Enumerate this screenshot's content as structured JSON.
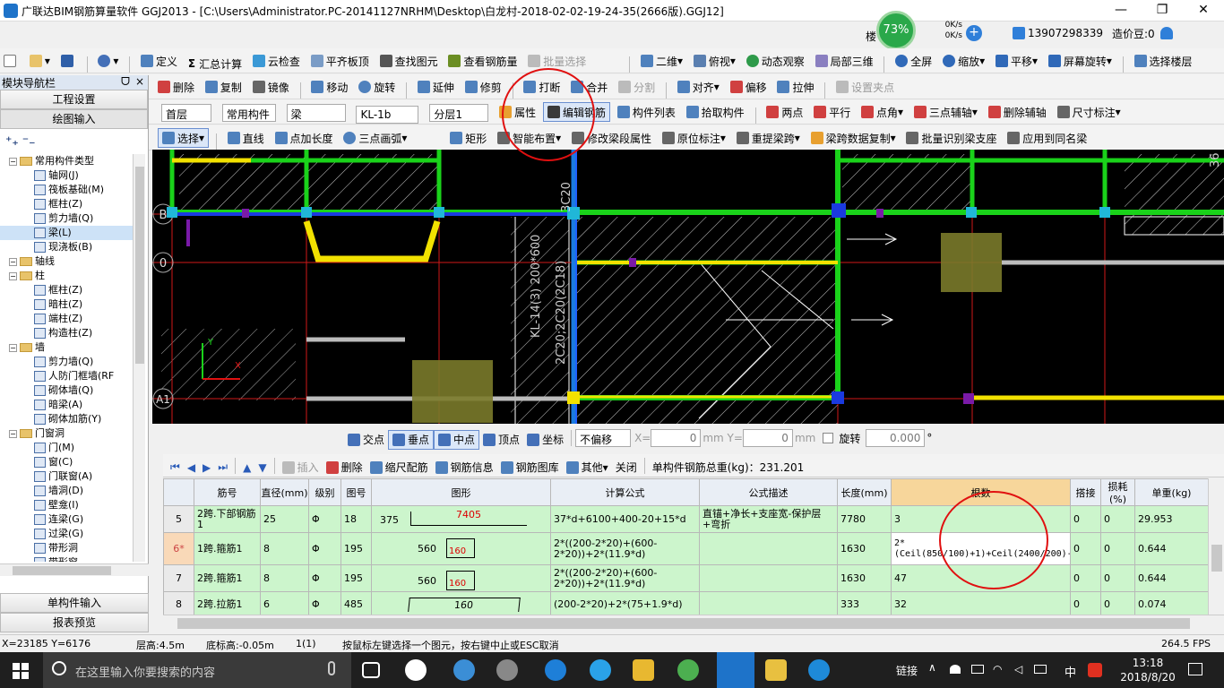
{
  "window": {
    "title": "广联达BIM钢筋算量软件 GGJ2013 - [C:\\Users\\Administrator.PC-20141127NRHM\\Desktop\\白龙村-2018-02-02-19-24-35(2666版).GGJ12]",
    "minimize": "—",
    "restore": "❐",
    "close": "✕"
  },
  "overlay": {
    "badge_prefix": "楼",
    "percent": "73%",
    "net_up": "0K/s",
    "net_down": "0K/s",
    "account": "13907298339",
    "beans": "造价豆:0"
  },
  "toolbar1": {
    "items": [
      "定义",
      "汇总计算",
      "云检查",
      "平齐板顶",
      "查找图元",
      "查看钢筋量",
      "批量选择",
      "二维",
      "俯视",
      "动态观察",
      "局部三维",
      "全屏",
      "缩放",
      "平移",
      "屏幕旋转",
      "选择楼层"
    ]
  },
  "toolbar2": {
    "items": [
      "删除",
      "复制",
      "镜像",
      "移动",
      "旋转",
      "延伸",
      "修剪",
      "打断",
      "合并",
      "分割",
      "对齐",
      "偏移",
      "拉伸",
      "设置夹点"
    ]
  },
  "toolbar3": {
    "floor": "首层",
    "type": "常用构件",
    "kind": "梁",
    "component": "KL-1b",
    "layer": "分层1",
    "items": [
      "属性",
      "编辑钢筋",
      "构件列表",
      "拾取构件",
      "两点",
      "平行",
      "点角",
      "三点辅轴",
      "删除辅轴",
      "尺寸标注"
    ]
  },
  "toolbar4": {
    "items": [
      "选择",
      "直线",
      "点加长度",
      "三点画弧",
      "矩形",
      "智能布置",
      "修改梁段属性",
      "原位标注",
      "重提梁跨",
      "梁跨数据复制",
      "批量识别梁支座",
      "应用到同名梁"
    ]
  },
  "leftpanel": {
    "title": "模块导航栏",
    "pin": "ᗜ",
    "close": "×",
    "btn_project": "工程设置",
    "btn_draw": "绘图输入",
    "tree": [
      {
        "label": "常用构件类型",
        "level": 0,
        "type": "folder"
      },
      {
        "label": "轴网(J)",
        "level": 1,
        "type": "item"
      },
      {
        "label": "筏板基础(M)",
        "level": 1,
        "type": "item"
      },
      {
        "label": "框柱(Z)",
        "level": 1,
        "type": "item"
      },
      {
        "label": "剪力墙(Q)",
        "level": 1,
        "type": "item"
      },
      {
        "label": "梁(L)",
        "level": 1,
        "type": "item",
        "selected": true
      },
      {
        "label": "现浇板(B)",
        "level": 1,
        "type": "item"
      },
      {
        "label": "轴线",
        "level": 0,
        "type": "folder"
      },
      {
        "label": "柱",
        "level": 0,
        "type": "folder"
      },
      {
        "label": "框柱(Z)",
        "level": 1,
        "type": "item"
      },
      {
        "label": "暗柱(Z)",
        "level": 1,
        "type": "item"
      },
      {
        "label": "端柱(Z)",
        "level": 1,
        "type": "item"
      },
      {
        "label": "构造柱(Z)",
        "level": 1,
        "type": "item"
      },
      {
        "label": "墙",
        "level": 0,
        "type": "folder"
      },
      {
        "label": "剪力墙(Q)",
        "level": 1,
        "type": "item"
      },
      {
        "label": "人防门框墙(RF",
        "level": 1,
        "type": "item"
      },
      {
        "label": "砌体墙(Q)",
        "level": 1,
        "type": "item"
      },
      {
        "label": "暗梁(A)",
        "level": 1,
        "type": "item"
      },
      {
        "label": "砌体加筋(Y)",
        "level": 1,
        "type": "item"
      },
      {
        "label": "门窗洞",
        "level": 0,
        "type": "folder"
      },
      {
        "label": "门(M)",
        "level": 1,
        "type": "item"
      },
      {
        "label": "窗(C)",
        "level": 1,
        "type": "item"
      },
      {
        "label": "门联窗(A)",
        "level": 1,
        "type": "item"
      },
      {
        "label": "墙洞(D)",
        "level": 1,
        "type": "item"
      },
      {
        "label": "壁龛(I)",
        "level": 1,
        "type": "item"
      },
      {
        "label": "连梁(G)",
        "level": 1,
        "type": "item"
      },
      {
        "label": "过梁(G)",
        "level": 1,
        "type": "item"
      },
      {
        "label": "带形洞",
        "level": 1,
        "type": "item"
      },
      {
        "label": "带形窗",
        "level": 1,
        "type": "item"
      }
    ],
    "btn_single": "单构件输入",
    "btn_report": "报表预览"
  },
  "canvas": {
    "axis_labels": [
      "B",
      "0",
      "A1"
    ],
    "beam_text": "KL-14(3) 200*600",
    "beam_text2": "2C20;2C20(2C18)",
    "rebar_text": "3C20",
    "top_right_text": "36"
  },
  "snapbar": {
    "items": [
      "交点",
      "垂点",
      "中点",
      "顶点",
      "坐标"
    ],
    "offset_mode": "不偏移",
    "x_label": "X=",
    "x_value": "0",
    "y_label": "mm Y=",
    "y_value": "0",
    "mm": "mm",
    "rotate_label": "旋转",
    "rotate_value": "0.000",
    "deg": "°"
  },
  "rebar_toolbar": {
    "insert": "插入",
    "delete": "删除",
    "scale": "缩尺配筋",
    "info": "钢筋信息",
    "library": "钢筋图库",
    "other": "其他",
    "close": "关闭",
    "total": "单构件钢筋总重(kg)：231.201"
  },
  "grid": {
    "headers": [
      "",
      "筋号",
      "直径(mm)",
      "级别",
      "图号",
      "图形",
      "计算公式",
      "公式描述",
      "长度(mm)",
      "根数",
      "搭接",
      "损耗(%)",
      "单重(kg)"
    ],
    "rows": [
      {
        "rn": "5",
        "name": "2跨.下部钢筋1",
        "dia": "25",
        "grade": "Φ",
        "fig": "18",
        "shape_left": "375",
        "shape_mid": "7405",
        "shape_right": "",
        "formula": "37*d+6100+400-20+15*d",
        "desc": "直锚+净长+支座宽-保护层+弯折",
        "len": "7780",
        "count": "3",
        "lap": "0",
        "loss": "0",
        "weight": "29.953"
      },
      {
        "rn": "6*",
        "name": "1跨.箍筋1",
        "dia": "8",
        "grade": "Φ",
        "fig": "195",
        "shape_left": "560",
        "shape_mid": "160",
        "shape_right": "",
        "formula": "2*((200-2*20)+(600-2*20))+2*(11.9*d)",
        "desc": "",
        "len": "1630",
        "count": "2*(Ceil(850/100)+1)+Ceil(2400/200)-1+6+6",
        "lap": "0",
        "loss": "0",
        "weight": "0.644"
      },
      {
        "rn": "7",
        "name": "2跨.箍筋1",
        "dia": "8",
        "grade": "Φ",
        "fig": "195",
        "shape_left": "560",
        "shape_mid": "160",
        "shape_right": "",
        "formula": "2*((200-2*20)+(600-2*20))+2*(11.9*d)",
        "desc": "",
        "len": "1630",
        "count": "47",
        "lap": "0",
        "loss": "0",
        "weight": "0.644"
      },
      {
        "rn": "8",
        "name": "2跨.拉筋1",
        "dia": "6",
        "grade": "Φ",
        "fig": "485",
        "shape_left": "",
        "shape_mid": "160",
        "shape_right": "",
        "formula": "(200-2*20)+2*(75+1.9*d)",
        "desc": "",
        "len": "333",
        "count": "32",
        "lap": "0",
        "loss": "0",
        "weight": "0.074"
      }
    ]
  },
  "status": {
    "coords": "X=23185 Y=6176",
    "floor_h": "层高:4.5m",
    "bottom_h": "底标高:-0.05m",
    "count": "1(1)",
    "hint": "按鼠标左键选择一个图元，按右键中止或ESC取消",
    "fps": "264.5 FPS"
  },
  "taskbar": {
    "search_placeholder": "在这里输入你要搜索的内容",
    "link": "链接",
    "ime": "中",
    "time": "13:18",
    "date": "2018/8/20"
  },
  "colors": {
    "beam_green": "#1ad21a",
    "column_cyan": "#20b7d8",
    "highlight_red": "#e01010",
    "row_green": "#ccf5cc"
  }
}
